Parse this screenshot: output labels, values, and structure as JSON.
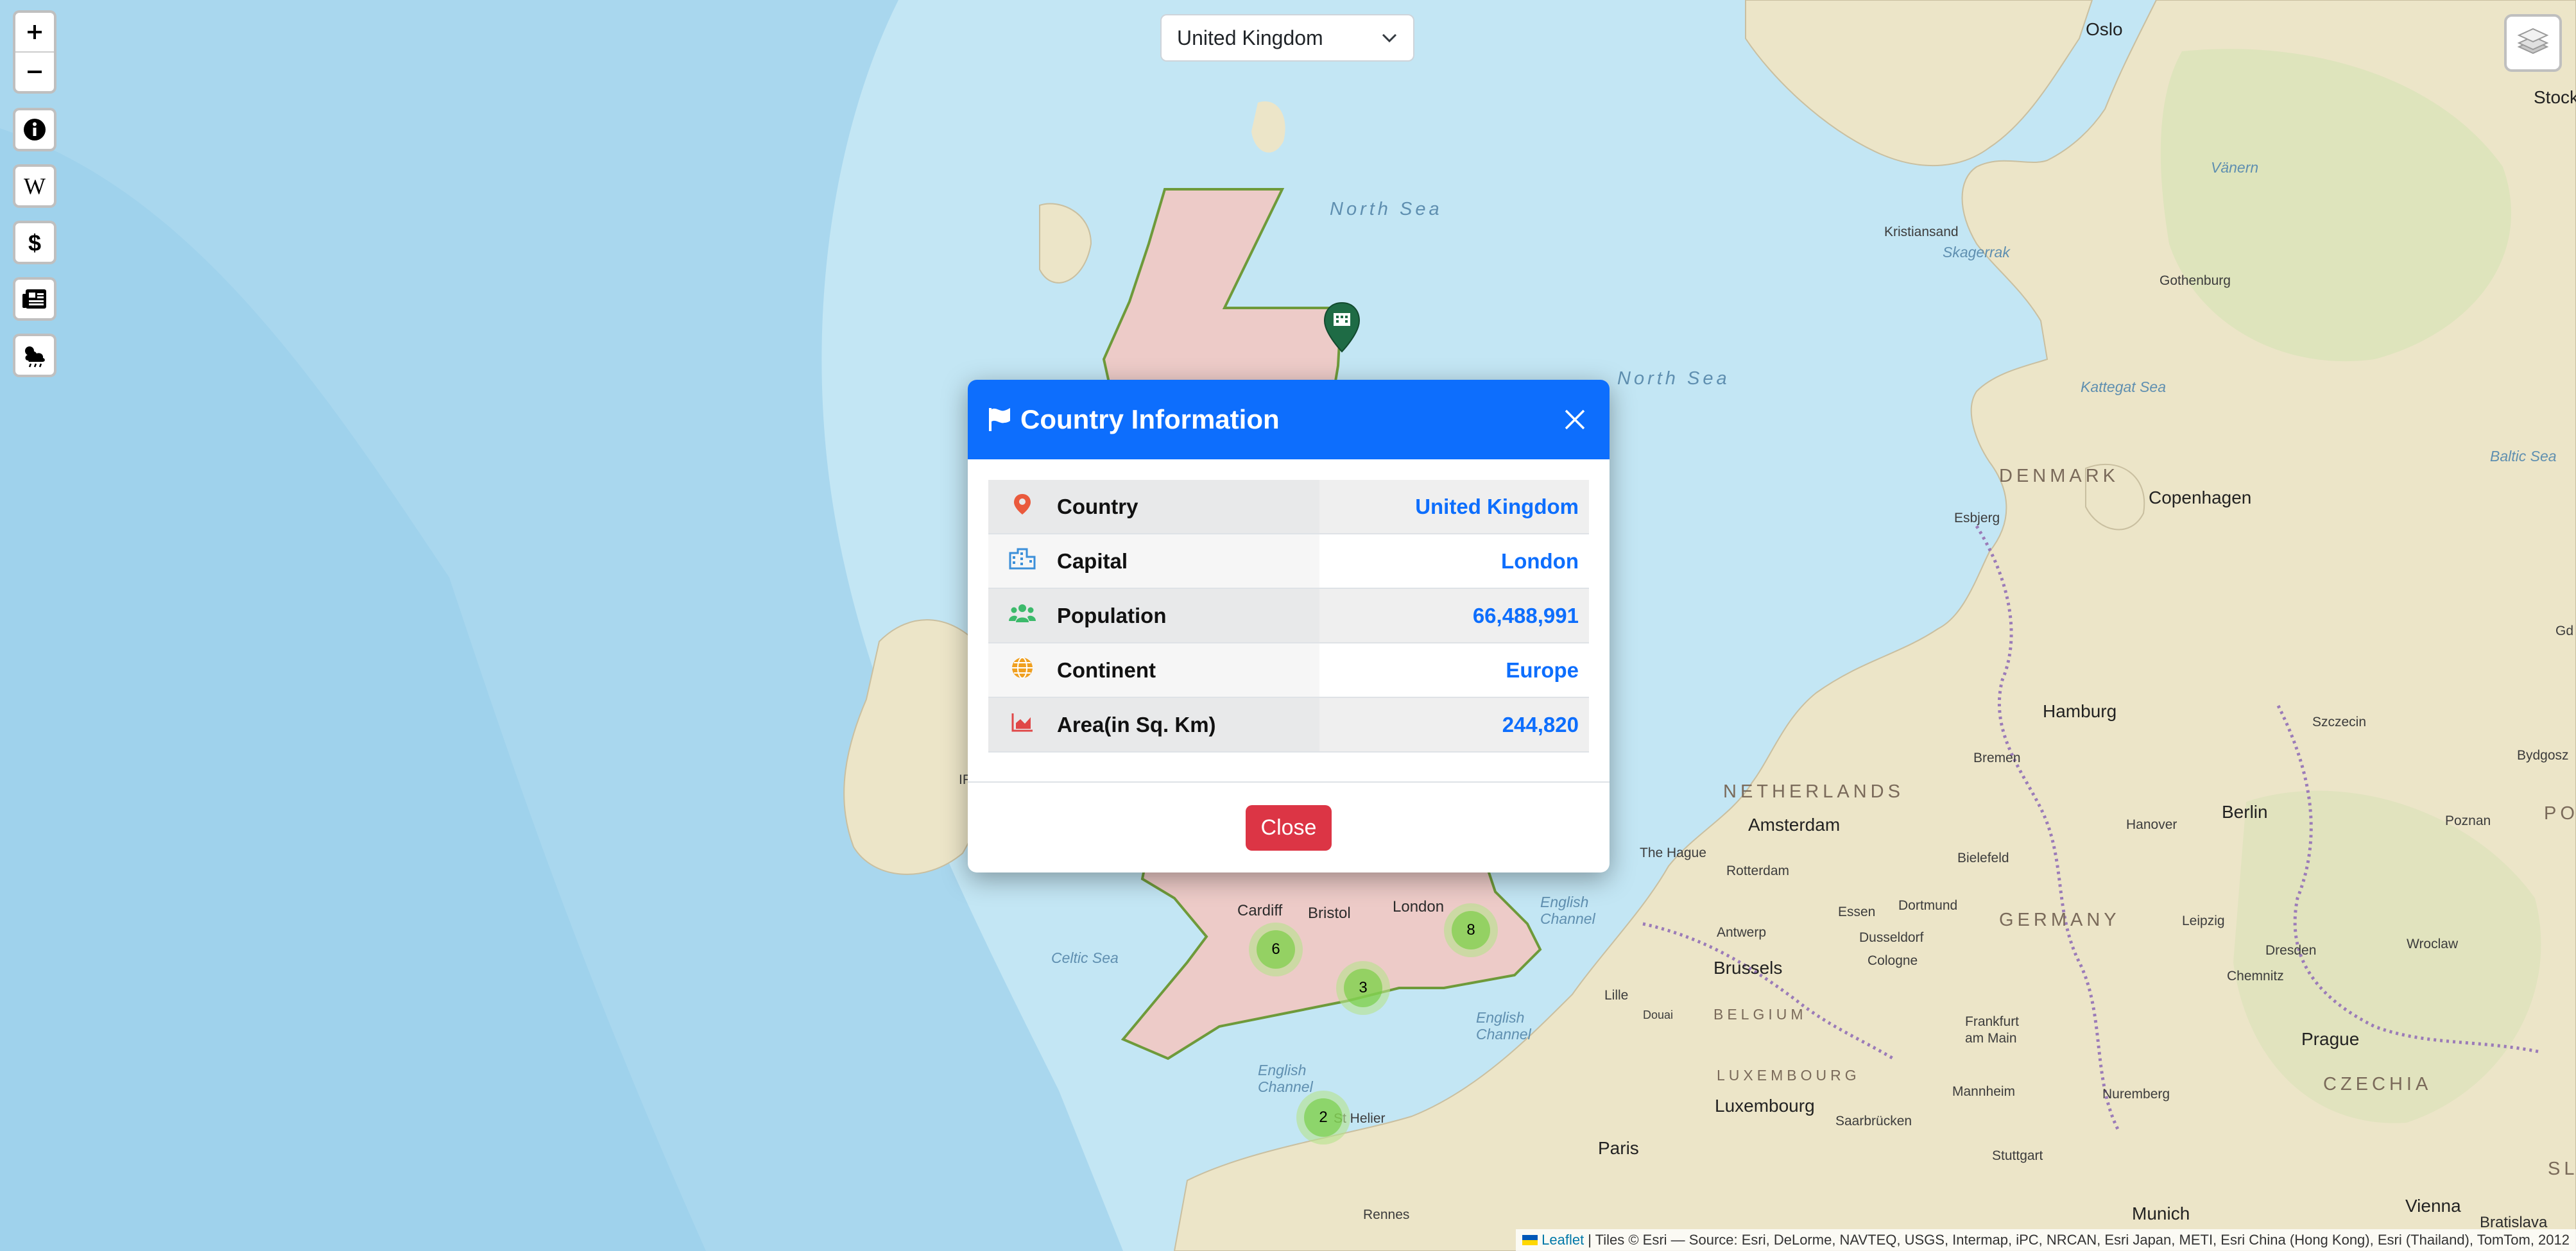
{
  "search": {
    "selected_country": "United Kingdom"
  },
  "map_labels": {
    "north_sea_1": "North Sea",
    "north_sea_2": "North Sea",
    "skagerrak": "Skagerrak",
    "kattegat": "Kattegat Sea",
    "baltic": "Baltic Sea",
    "celtic": "Celtic Sea",
    "english_channel_1": "English Channel",
    "english_channel_2": "English Channel",
    "english_channel_3": "English Channel",
    "vanern": "Vänern",
    "denmark": "DENMARK",
    "netherlands": "NETHERLANDS",
    "belgium": "BELGIUM",
    "luxembourg_c": "LUXEMBOURG",
    "germany": "GERMANY",
    "czechia": "CZECHIA",
    "oslo": "Oslo",
    "stockholm": "Stockho",
    "kristiansand": "Kristiansand",
    "gothenburg": "Gothenburg",
    "esbjerg": "Esbjerg",
    "copenhagen": "Copenhagen",
    "hamburg": "Hamburg",
    "szczecin": "Szczecin",
    "gdansk": "Gd",
    "bydgoszcz": "Bydgosz",
    "bremen": "Bremen",
    "amsterdam": "Amsterdam",
    "hanover": "Hanover",
    "berlin": "Berlin",
    "poznan": "Poznan",
    "po": "PO",
    "the_hague": "The Hague",
    "rotterdam": "Rotterdam",
    "bielefeld": "Bielefeld",
    "essen": "Essen",
    "dortmund": "Dortmund",
    "dusseldorf": "Dusseldorf",
    "antwerp": "Antwerp",
    "cologne": "Cologne",
    "leipzig": "Leipzig",
    "dresden": "Dresden",
    "wroclaw": "Wroclaw",
    "brussels": "Brussels",
    "chemnitz": "Chemnitz",
    "lille": "Lille",
    "douai": "Douai",
    "frankfurt": "Frankfurt am Main",
    "prague": "Prague",
    "luxembourg": "Luxembourg",
    "mannheim": "Mannheim",
    "nuremberg": "Nuremberg",
    "saarbrucken": "Saarbrücken",
    "stuttgart": "Stuttgart",
    "paris": "Paris",
    "munich": "Munich",
    "vienna": "Vienna",
    "bratislava": "Bratislava",
    "sl": "SL",
    "rennes": "Rennes",
    "st_helier": "St Helier",
    "cardiff": "Cardiff",
    "bristol": "Bristol",
    "london": "London",
    "ir": "IR"
  },
  "clusters": [
    {
      "count": "6"
    },
    {
      "count": "3"
    },
    {
      "count": "8"
    },
    {
      "count": "2"
    }
  ],
  "modal": {
    "title": "Country Information",
    "rows": [
      {
        "label": "Country",
        "value": "United Kingdom",
        "icon": "location-pin-icon",
        "icon_color": "#ea5a3d"
      },
      {
        "label": "Capital",
        "value": "London",
        "icon": "city-icon",
        "icon_color": "#3b8fd9"
      },
      {
        "label": "Population",
        "value": "66,488,991",
        "icon": "people-icon",
        "icon_color": "#3cba6b"
      },
      {
        "label": "Continent",
        "value": "Europe",
        "icon": "globe-icon",
        "icon_color": "#f0a020"
      },
      {
        "label": "Area(in Sq. Km)",
        "value": "244,820",
        "icon": "area-chart-icon",
        "icon_color": "#e04848"
      }
    ],
    "close_label": "Close"
  },
  "attribution": {
    "leaflet": "Leaflet",
    "text": "| Tiles © Esri — Source: Esri, DeLorme, NAVTEQ, USGS, Intermap, iPC, NRCAN, Esri Japan, METI, Esri China (Hong Kong), Esri (Thailand), TomTom, 2012"
  },
  "colors": {
    "modal_header": "#0d6efd",
    "close_button": "#dc3545",
    "value_text": "#0d6efd",
    "sea": "#bfe4f3",
    "land": "#ece5c8",
    "highlight_fill": "#f4c5c0",
    "highlight_border": "#6e9a3a",
    "marker": "#1e6b45"
  }
}
